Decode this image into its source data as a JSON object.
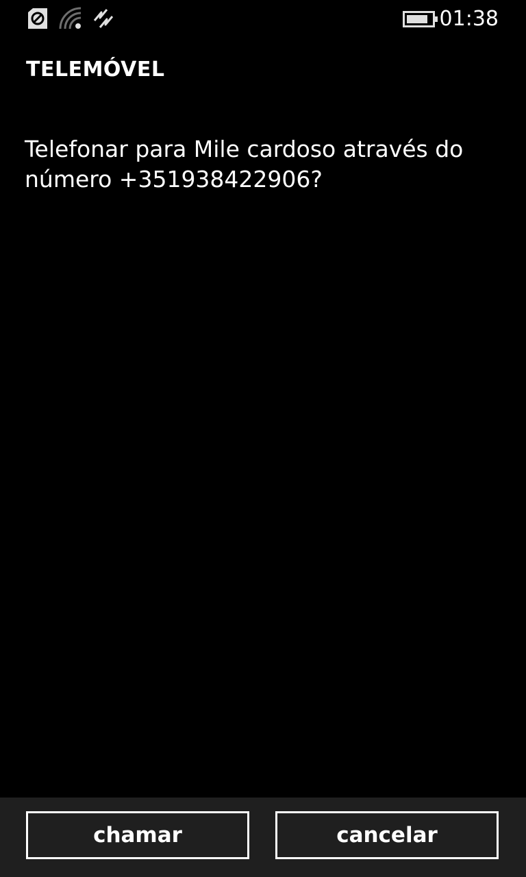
{
  "status_bar": {
    "time": "01:38",
    "icons": [
      "sim-lock-icon",
      "wifi-signal-icon",
      "vibrate-icon",
      "battery-icon"
    ]
  },
  "app": {
    "title": "TELEMÓVEL",
    "message": "Telefonar para Mile cardoso através do número +351938422906?"
  },
  "actions": {
    "call_label": "chamar",
    "cancel_label": "cancelar"
  },
  "colors": {
    "background": "#000000",
    "app_bar": "#1f1f1f",
    "text": "#ffffff"
  }
}
